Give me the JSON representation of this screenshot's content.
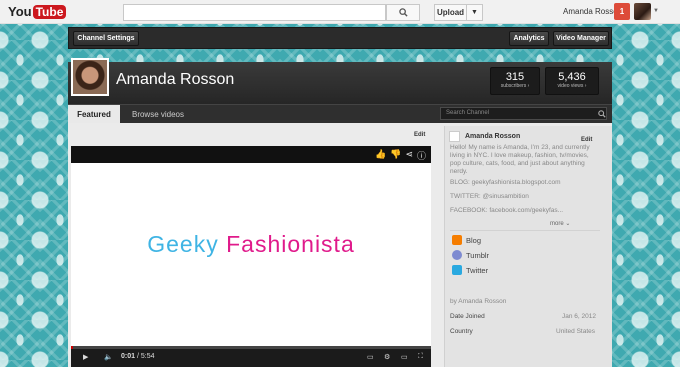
{
  "masthead": {
    "logo_you": "You",
    "logo_tube": "Tube",
    "search_placeholder": "",
    "upload_label": "Upload",
    "user_name": "Amanda Rosson",
    "notification_count": "1"
  },
  "toolbar": {
    "channel_settings": "Channel Settings",
    "analytics": "Analytics",
    "video_manager": "Video Manager"
  },
  "channel": {
    "name": "Amanda Rosson",
    "subscribers_count": "315",
    "subscribers_label": "subscribers ›",
    "views_count": "5,436",
    "views_label": "video views ›"
  },
  "tabs": {
    "featured": "Featured",
    "browse": "Browse videos",
    "search_placeholder": "Search Channel"
  },
  "player": {
    "edit_label": "Edit",
    "video_title_part1": "Geeky",
    "video_title_part2": "Fashionista",
    "time_current": "0:01",
    "time_total": "5:54",
    "progress_fraction": 0.003
  },
  "sidebar": {
    "name": "Amanda Rosson",
    "edit_label": "Edit",
    "about": "Hello! My name is Amanda, I'm 23, and currently living in NYC. I love makeup, fashion, tv/movies, pop culture, cats, food, and just about anything nerdy.",
    "blog_line": "BLOG: geekyfashionista.blogspot.com",
    "twitter_line": "TWITTER: @sinusambition",
    "facebook_line": "FACEBOOK: facebook.com/geekyfas...",
    "more_label": "more ⌄",
    "links": [
      {
        "label": "Blog",
        "icon": "blogger-icon",
        "color": "#f57d00"
      },
      {
        "label": "Tumblr",
        "icon": "tumblr-icon",
        "color": "#7e8bd1"
      },
      {
        "label": "Twitter",
        "icon": "twitter-icon",
        "color": "#2aa9e0"
      }
    ],
    "by_line": "by Amanda Rosson",
    "date_joined_label": "Date Joined",
    "date_joined_value": "Jan 6, 2012",
    "country_label": "Country",
    "country_value": "United States"
  },
  "colors": {
    "accent_red": "#cc181e",
    "notification_red": "#dd4b39",
    "pattern_teal": "#3fa9b0",
    "title_blue": "#3fb4e4",
    "title_pink": "#e01a8b"
  }
}
